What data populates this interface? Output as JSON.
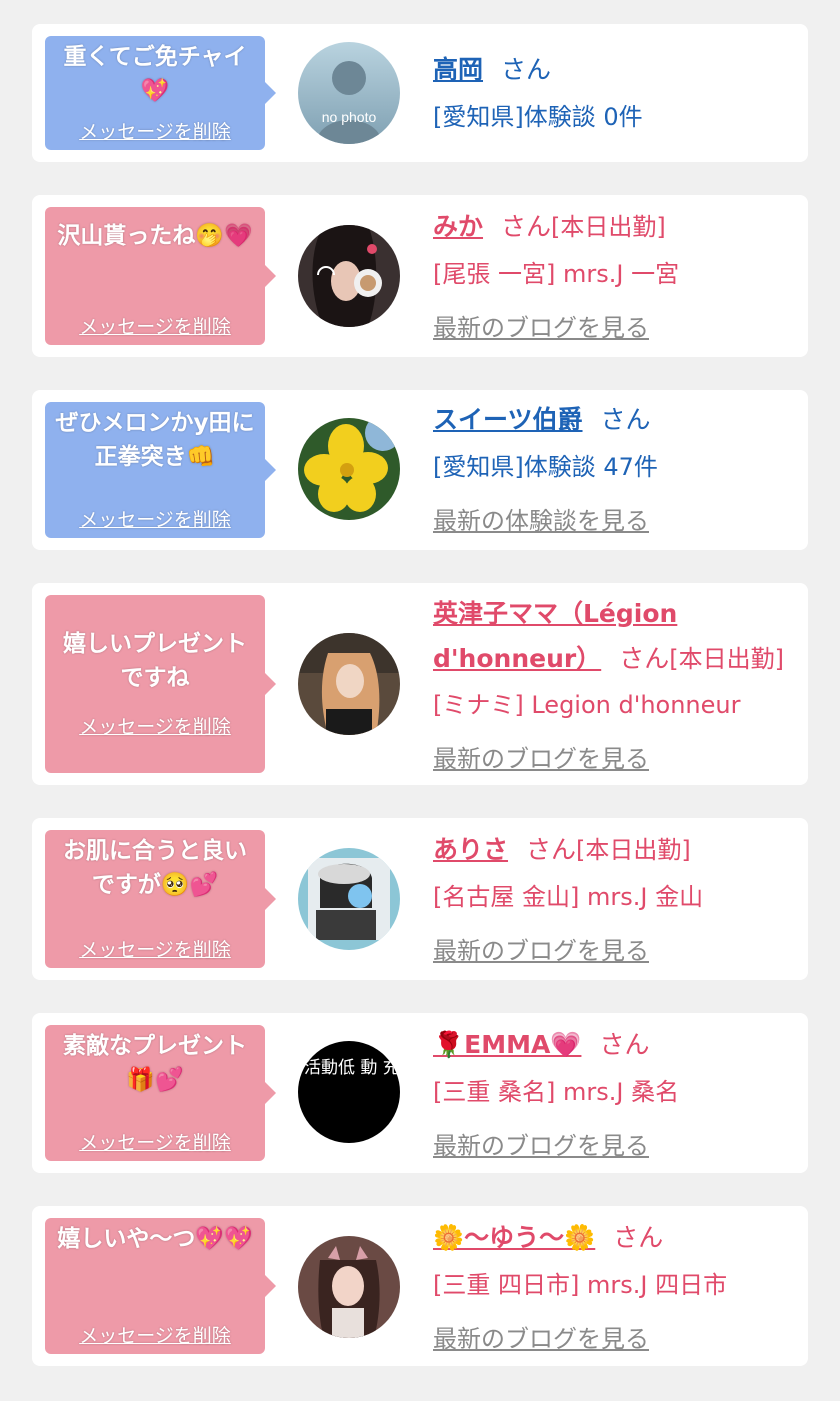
{
  "items": [
    {
      "message": "重くてご免チャイ💖",
      "delete_label": "メッセージを削除",
      "name": "高岡",
      "honorific": "さん",
      "status": "",
      "detail": "[愛知県]体験談 0件",
      "link": "",
      "avatar_text": "no photo",
      "color": "blue"
    },
    {
      "message": "沢山貰ったね🤭💗",
      "delete_label": "メッセージを削除",
      "name": "みか",
      "honorific": "さん",
      "status": "[本日出勤]",
      "detail": "[尾張 一宮] mrs.J 一宮",
      "link": "最新のブログを見る",
      "color": "pink"
    },
    {
      "message": "ぜひメロンかy田に正拳突き👊",
      "delete_label": "メッセージを削除",
      "name": "スイーツ伯爵",
      "honorific": "さん",
      "status": "",
      "detail": "[愛知県]体験談 47件",
      "link": "最新の体験談を見る",
      "color": "blue"
    },
    {
      "message": "嬉しいプレゼントですね",
      "delete_label": "メッセージを削除",
      "name": "英津子ママ（Légion d'honneur）",
      "honorific": "さん",
      "status": "[本日出勤]",
      "detail": "[ミナミ] Legion d'honneur",
      "link": "最新のブログを見る",
      "color": "pink"
    },
    {
      "message": "お肌に合うと良いですが🥺💕",
      "delete_label": "メッセージを削除",
      "name": "ありさ",
      "honorific": "さん",
      "status": "[本日出勤]",
      "detail": "[名古屋 金山] mrs.J 金山",
      "link": "最新のブログを見る",
      "color": "pink"
    },
    {
      "message": "素敵なプレゼント🎁💕",
      "delete_label": "メッセージを削除",
      "name": "🌹EMMA💗",
      "honorific": "さん",
      "status": "",
      "detail": "[三重 桑名] mrs.J 桑名",
      "link": "最新のブログを見る",
      "avatar_text": "活動低 動 充 中。",
      "color": "pink"
    },
    {
      "message": "嬉しいや〜つ💖💖",
      "delete_label": "メッセージを削除",
      "name": "🌼〜ゆう〜🌼",
      "honorific": "さん",
      "status": "",
      "detail": "[三重 四日市] mrs.J 四日市",
      "link": "最新のブログを見る",
      "color": "pink"
    }
  ]
}
